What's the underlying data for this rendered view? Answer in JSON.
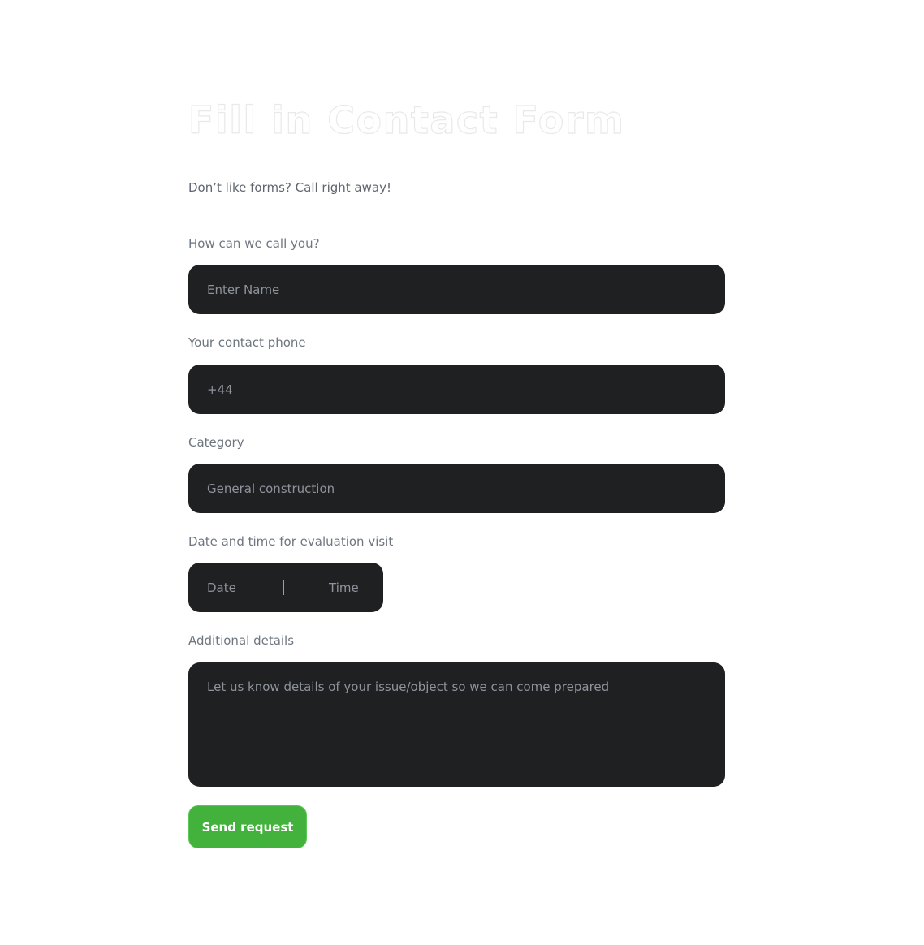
{
  "form": {
    "title": "Fill in Contact Form",
    "subtitle": "Don’t like forms? Call right away!",
    "name": {
      "label": "How can we call you?",
      "placeholder": "Enter Name"
    },
    "phone": {
      "label": "Your contact phone",
      "placeholder": "+44"
    },
    "category": {
      "label": "Category",
      "value": "General construction"
    },
    "visit": {
      "label": "Date and time for evaluation visit",
      "date_placeholder": "Date",
      "time_placeholder": "Time"
    },
    "details": {
      "label": "Additional details",
      "placeholder": "Let us know details of your issue/object so we can come prepared"
    },
    "submit_label": "Send request"
  },
  "colors": {
    "field_background": "#1f2022",
    "submit_background": "#43b23d",
    "label_text": "#6e7680",
    "placeholder_text": "#8e939b"
  }
}
